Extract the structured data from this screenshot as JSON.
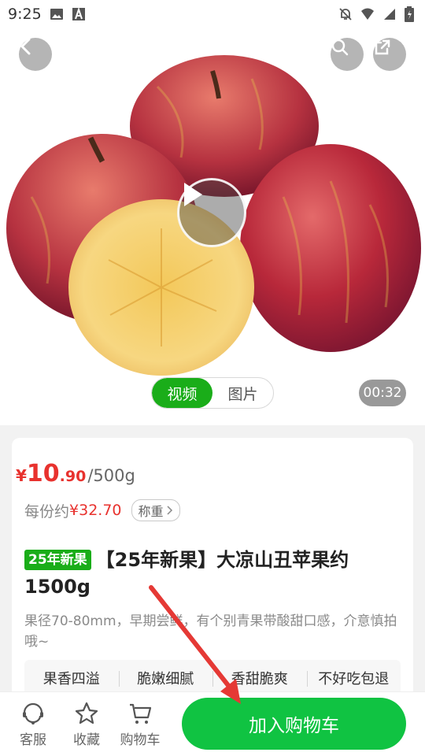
{
  "status_bar": {
    "time": "9:25",
    "icons": [
      "image-icon",
      "font-a-icon",
      "mute-bell-icon",
      "wifi-icon",
      "signal-icon",
      "battery-icon"
    ]
  },
  "hero": {
    "media_tabs": [
      {
        "label": "视频",
        "active": true
      },
      {
        "label": "图片",
        "active": false
      }
    ],
    "duration": "00:32",
    "icons": {
      "back": "chevron-left-icon",
      "search": "search-icon",
      "share": "share-icon",
      "play": "play-icon"
    }
  },
  "product": {
    "price": {
      "currency": "¥",
      "integer": "10",
      "decimal": ".90",
      "unit": "/500g"
    },
    "each": {
      "label": "每份约",
      "price": "¥32.70",
      "weigh_label": "称重"
    },
    "badge": "25年新果",
    "title": "【25年新果】大凉山丑苹果约1500g",
    "description": "果径70-80mm，早期尝鲜，有个别青果带酸甜口感，介意慎拍哦~",
    "tags": [
      "果香四溢",
      "脆嫩细腻",
      "香甜脆爽",
      "不好吃包退"
    ]
  },
  "bottom_bar": {
    "items": [
      {
        "label": "客服",
        "icon": "customer-service-icon"
      },
      {
        "label": "收藏",
        "icon": "star-icon"
      },
      {
        "label": "购物车",
        "icon": "cart-icon"
      }
    ],
    "add_to_cart": "加入购物车"
  },
  "colors": {
    "brand_green": "#1aad19",
    "cta_green": "#10c342",
    "price_red": "#e8322e",
    "annotation_red": "#e53935"
  }
}
